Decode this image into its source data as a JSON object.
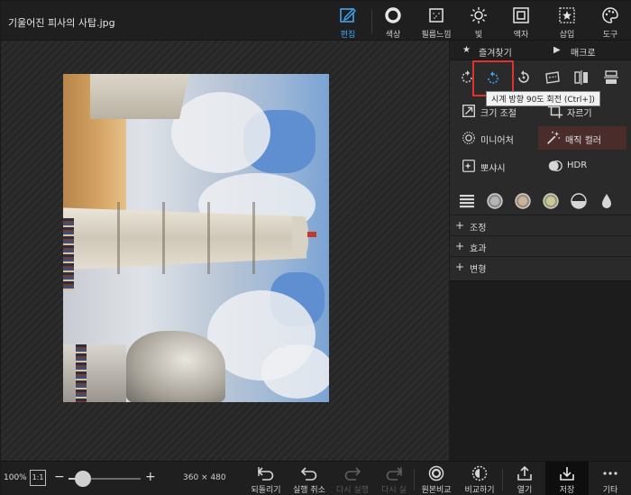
{
  "file": {
    "title": "기울어진 피사의 사탑.jpg"
  },
  "toolbar": {
    "items": [
      {
        "id": "edit",
        "label": "편집",
        "icon": "edit-icon"
      },
      {
        "id": "color",
        "label": "색상",
        "icon": "circle-icon"
      },
      {
        "id": "film",
        "label": "필름느낌",
        "icon": "film-icon"
      },
      {
        "id": "light",
        "label": "빛",
        "icon": "sun-icon"
      },
      {
        "id": "frame",
        "label": "액자",
        "icon": "frame-icon"
      },
      {
        "id": "insert",
        "label": "삽입",
        "icon": "star-box-icon"
      },
      {
        "id": "tools",
        "label": "도구",
        "icon": "palette-icon"
      }
    ],
    "active": "edit"
  },
  "panel": {
    "favorites_label": "즐겨찾기",
    "macro_label": "매크로",
    "tooltip": "시계 방향 90도 회전 (Ctrl+])",
    "tools": [
      {
        "id": "resize",
        "label": "크기 조절",
        "icon": "resize-icon"
      },
      {
        "id": "crop",
        "label": "자르기",
        "icon": "crop-icon"
      },
      {
        "id": "miniature",
        "label": "미니어처",
        "icon": "miniature-icon"
      },
      {
        "id": "magic_color",
        "label": "매직 컬러",
        "icon": "magic-wand-icon"
      },
      {
        "id": "sharpen",
        "label": "뽀샤시",
        "icon": "sparkle-icon"
      },
      {
        "id": "hdr",
        "label": "HDR",
        "icon": "hdr-icon"
      }
    ],
    "sections": [
      {
        "label": "조정"
      },
      {
        "label": "효과"
      },
      {
        "label": "변형"
      }
    ]
  },
  "bottom": {
    "zoom": "100%",
    "zoom_level": 0.2,
    "actual_size_label": "1:1",
    "dimensions": "360 × 480",
    "actions": {
      "revert": "되돌리기",
      "undo": "실행 취소",
      "redo": "다시 실행",
      "redo_all": "다시 실",
      "compare_original": "원본비교",
      "compare": "비교하기",
      "open": "열기",
      "save": "저장",
      "more": "기타"
    }
  },
  "colors": {
    "accent": "#3ea4f0",
    "highlight_border": "#e0322a",
    "highlight_button": "#4a2c2a"
  }
}
